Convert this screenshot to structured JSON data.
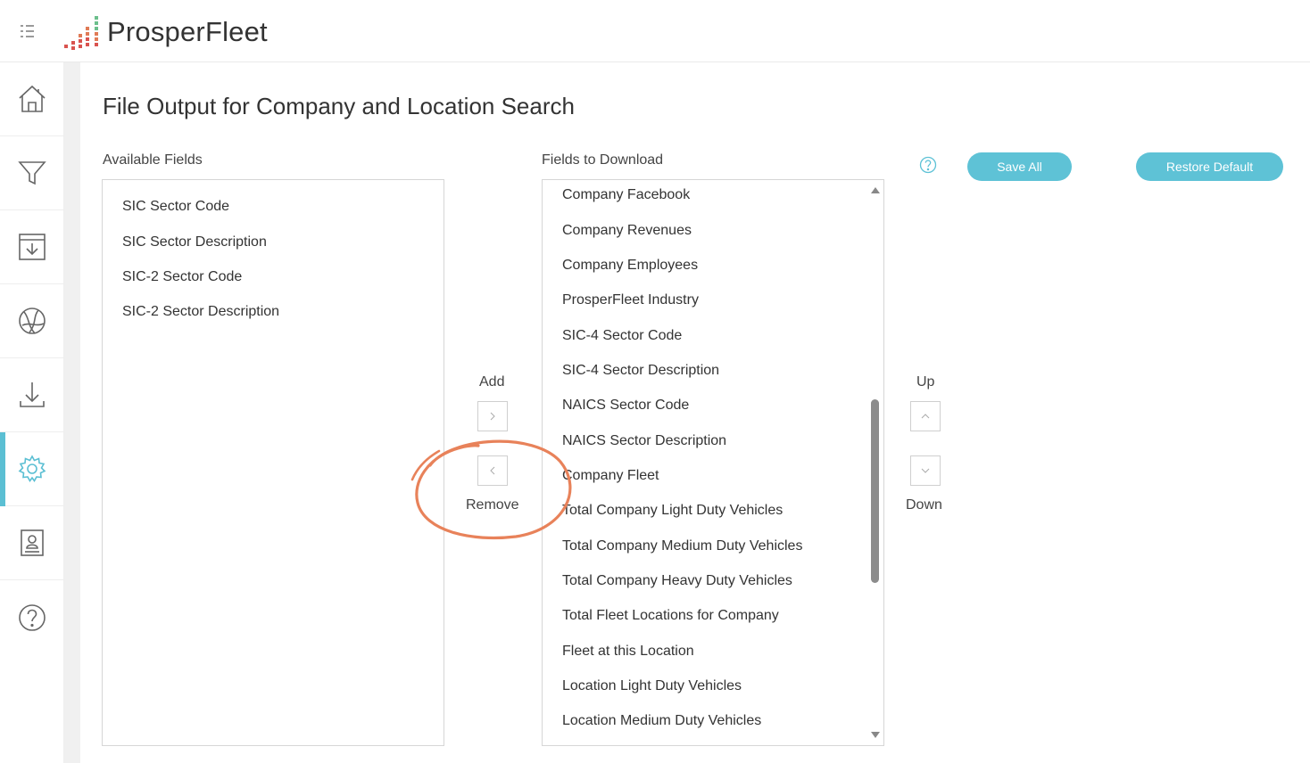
{
  "app": {
    "name": "ProsperFleet"
  },
  "sidebar": {
    "items": [
      {
        "name": "home",
        "icon": "home-icon"
      },
      {
        "name": "filter",
        "icon": "filter-icon"
      },
      {
        "name": "saved",
        "icon": "save-download-icon"
      },
      {
        "name": "map",
        "icon": "globe-icon"
      },
      {
        "name": "download",
        "icon": "download-icon"
      },
      {
        "name": "settings",
        "icon": "gear-icon",
        "active": true
      },
      {
        "name": "profile",
        "icon": "contact-card-icon"
      },
      {
        "name": "help",
        "icon": "help-icon"
      }
    ]
  },
  "page": {
    "title": "File Output for Company and Location Search"
  },
  "available": {
    "label": "Available Fields",
    "items": [
      "SIC Sector Code",
      "SIC Sector Description",
      "SIC-2 Sector Code",
      "SIC-2 Sector Description"
    ]
  },
  "download": {
    "label": "Fields to Download",
    "items": [
      "Company Facebook",
      "Company Revenues",
      "Company Employees",
      "ProsperFleet Industry",
      "SIC-4 Sector Code",
      "SIC-4 Sector Description",
      "NAICS Sector Code",
      "NAICS Sector Description",
      "Company Fleet",
      "Total Company Light Duty Vehicles",
      "Total Company Medium Duty Vehicles",
      "Total Company Heavy Duty Vehicles",
      "Total Fleet Locations for Company",
      "Fleet at this Location",
      "Location Light Duty Vehicles",
      "Location Medium Duty Vehicles"
    ]
  },
  "controls": {
    "add_label": "Add",
    "remove_label": "Remove",
    "up_label": "Up",
    "down_label": "Down"
  },
  "actions": {
    "save_all": "Save All",
    "restore_default": "Restore Default"
  },
  "colors": {
    "accent": "#5ec2d6",
    "annotation": "#e8825a",
    "logo_red": "#d9534f",
    "logo_green": "#6cbf8c"
  }
}
